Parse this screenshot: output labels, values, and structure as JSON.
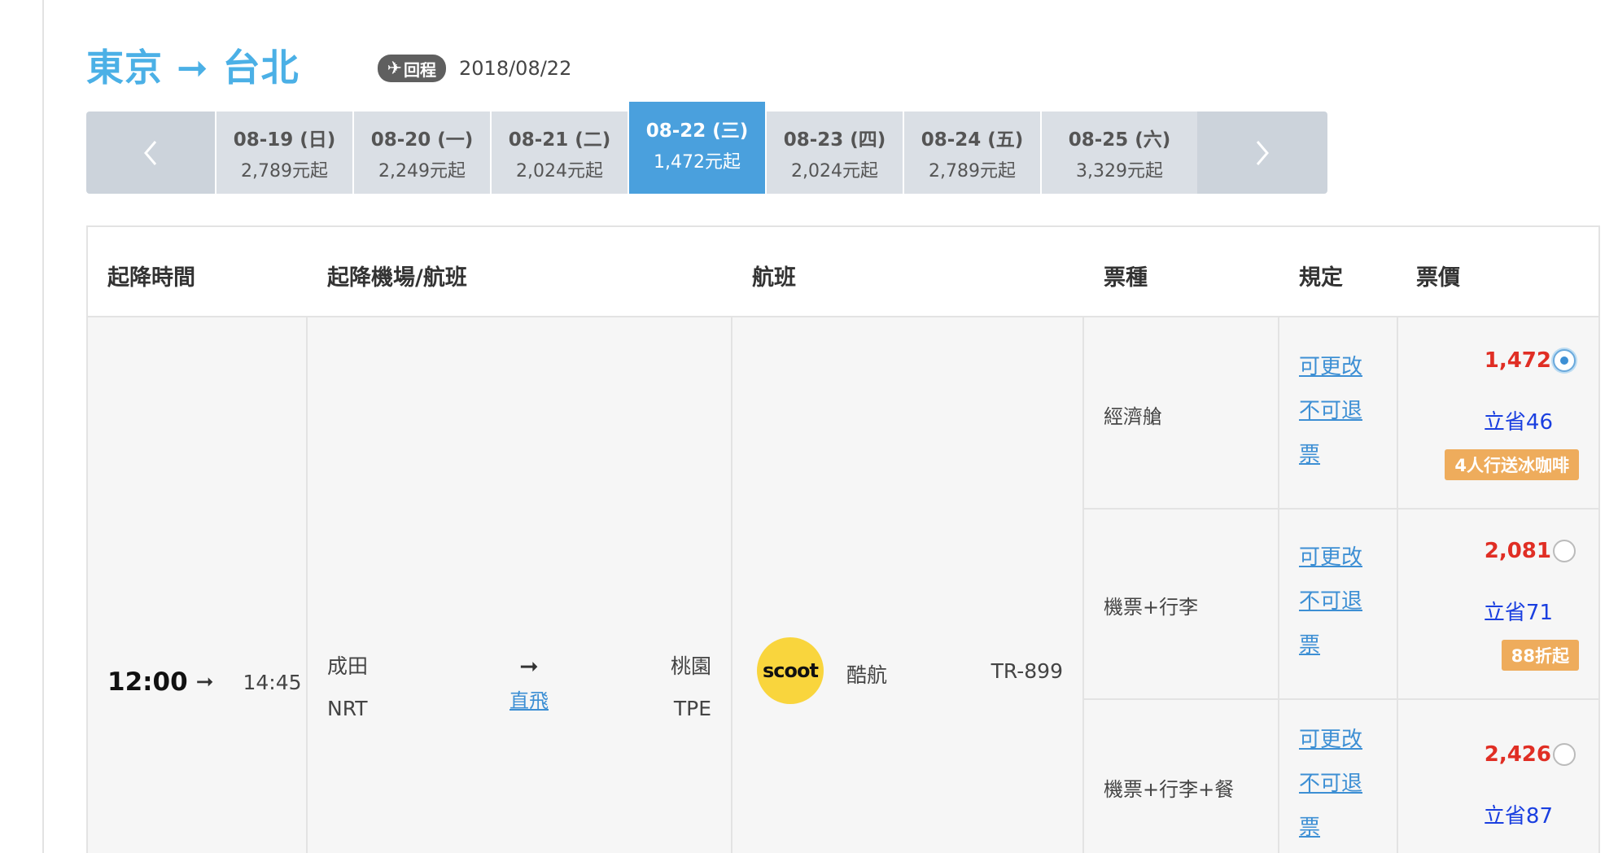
{
  "header": {
    "route": "東京 ➞ 台北",
    "trip_badge": "回程",
    "trip_date": "2018/08/22"
  },
  "date_bar": {
    "prev_icon": "chevron-left-icon",
    "next_icon": "chevron-right-icon",
    "days": [
      {
        "date": "08-19 (日)",
        "price": "2,789元起",
        "selected": false
      },
      {
        "date": "08-20 (一)",
        "price": "2,249元起",
        "selected": false
      },
      {
        "date": "08-21 (二)",
        "price": "2,024元起",
        "selected": false
      },
      {
        "date": "08-22 (三)",
        "price": "1,472元起",
        "selected": true
      },
      {
        "date": "08-23 (四)",
        "price": "2,024元起",
        "selected": false
      },
      {
        "date": "08-24 (五)",
        "price": "2,789元起",
        "selected": false
      },
      {
        "date": "08-25 (六)",
        "price": "3,329元起",
        "selected": false
      }
    ]
  },
  "table": {
    "headers": [
      "起降時間",
      "起降機場/航班",
      "航班",
      "票種",
      "規定",
      "票價"
    ],
    "flight": {
      "depart_time": "12:00",
      "arrive_time": "14:45",
      "from_name": "成田",
      "from_code": "NRT",
      "to_name": "桃園",
      "to_code": "TPE",
      "stop_type": "直飛",
      "airline_logo_text": "scoot",
      "airline": "酷航",
      "flight_no": "TR-899"
    },
    "fares": [
      {
        "type": "經濟艙",
        "change": "可更改",
        "refund_1": "不可退",
        "refund_2": "票",
        "price": "1,472",
        "save": "立省46",
        "promo": "4人行送冰咖啡",
        "selected": true
      },
      {
        "type": "機票+行李",
        "change": "可更改",
        "refund_1": "不可退",
        "refund_2": "票",
        "price": "2,081",
        "save": "立省71",
        "promo": "88折起",
        "selected": false
      },
      {
        "type": "機票+行李+餐",
        "change": "可更改",
        "refund_1": "不可退",
        "refund_2": "票",
        "price": "2,426",
        "save": "立省87",
        "promo": "",
        "selected": false
      }
    ]
  },
  "colors": {
    "route_blue": "#4bb0e6",
    "selected_day": "#4aa0dd",
    "price_red": "#e02e24",
    "save_blue": "#1a3fe0",
    "promo_orange": "#eeac5c",
    "logo_yellow": "#f9d53d"
  }
}
